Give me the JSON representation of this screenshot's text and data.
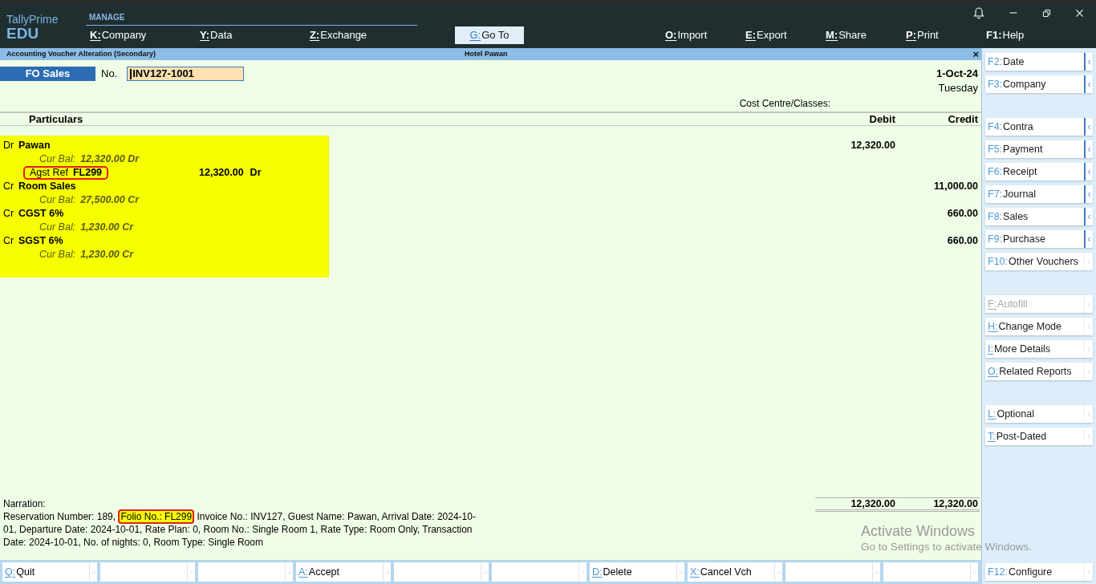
{
  "app": {
    "name": "TallyPrime",
    "edition": "EDU"
  },
  "top_menu": {
    "section": "MANAGE",
    "left_items": [
      {
        "key": "K:",
        "label": "Company"
      },
      {
        "key": "Y:",
        "label": "Data"
      },
      {
        "key": "Z:",
        "label": "Exchange"
      }
    ],
    "go_to": {
      "key": "G:",
      "label": "Go To",
      "selected": true
    },
    "right_items": [
      {
        "key": "O:",
        "label": "Import"
      },
      {
        "key": "E:",
        "label": "Export"
      },
      {
        "key": "M:",
        "label": "Share"
      },
      {
        "key": "P:",
        "label": "Print"
      },
      {
        "key": "F1:",
        "label": "Help"
      }
    ]
  },
  "title_bar": {
    "title": "Accounting Voucher Alteration (Secondary)",
    "company": "Hotel Pawan",
    "close": "×"
  },
  "voucher": {
    "type": "FO Sales",
    "no_label": "No.",
    "number": "INV127-1001",
    "date": "1-Oct-24",
    "day": "Tuesday",
    "cost_centre_label": "Cost Centre/Classes:"
  },
  "columns": [
    "Particulars",
    "Debit",
    "Credit"
  ],
  "entries": [
    {
      "side": "Dr",
      "ledger": "Pawan",
      "balance_label": "Cur Bal:",
      "balance": "12,320.00 Dr",
      "debit": "12,320.00",
      "bill": {
        "type": "Agst Ref",
        "name": "FL299",
        "amount": "12,320.00",
        "side": "Dr",
        "highlighted": true
      }
    },
    {
      "side": "Cr",
      "ledger": "Room Sales",
      "balance_label": "Cur Bal:",
      "balance": "27,500.00 Cr",
      "credit": "11,000.00"
    },
    {
      "side": "Cr",
      "ledger": "CGST 6%",
      "balance_label": "Cur Bal:",
      "balance": "1,230.00 Cr",
      "credit": "660.00"
    },
    {
      "side": "Cr",
      "ledger": "SGST 6%",
      "balance_label": "Cur Bal:",
      "balance": "1,230.00 Cr",
      "credit": "660.00"
    }
  ],
  "totals": {
    "debit": "12,320.00",
    "credit": "12,320.00"
  },
  "narration": {
    "label": "Narration:",
    "text_before": "Reservation Number: 189, ",
    "highlight": "Folio No.: FL299",
    "text_after": " Invoice No.: INV127, Guest Name: Pawan, Arrival Date: 2024-10-01, Departure Date: 2024-10-01, Rate Plan: 0, Room No.: Single Room 1, Rate Type: Room Only, Transaction Date: 2024-10-01, No. of nights: 0, Room Type: Single Room"
  },
  "right_panel": [
    [
      {
        "key": "F2:",
        "label": "Date",
        "disabled": false,
        "expandable": true
      },
      {
        "key": "F3:",
        "label": "Company",
        "disabled": false,
        "expandable": true
      }
    ],
    [
      {
        "key": "F4:",
        "label": "Contra",
        "disabled": false,
        "expandable": true
      },
      {
        "key": "F5:",
        "label": "Payment",
        "disabled": false,
        "expandable": true
      },
      {
        "key": "F6:",
        "label": "Receipt",
        "disabled": false,
        "expandable": true
      },
      {
        "key": "F7:",
        "label": "Journal",
        "disabled": false,
        "expandable": true
      },
      {
        "key": "F8:",
        "label": "Sales",
        "disabled": false,
        "expandable": true
      },
      {
        "key": "F9:",
        "label": "Purchase",
        "disabled": false,
        "expandable": true
      },
      {
        "key": "F10:",
        "label": "Other Vouchers",
        "disabled": false,
        "expandable": false
      }
    ],
    [
      {
        "key": "F:",
        "label": "Autofill",
        "disabled": true,
        "expandable": false
      },
      {
        "key": "H:",
        "label": "Change Mode",
        "disabled": false,
        "expandable": false
      },
      {
        "key": "I:",
        "label": "More Details",
        "disabled": false,
        "expandable": false
      },
      {
        "key": "O:",
        "label": "Related Reports",
        "disabled": false,
        "expandable": false
      }
    ],
    [
      {
        "key": "L:",
        "label": "Optional",
        "disabled": false,
        "expandable": false
      },
      {
        "key": "T:",
        "label": "Post-Dated",
        "disabled": false,
        "expandable": false
      }
    ]
  ],
  "bottom_bar": [
    {
      "kind": "action",
      "key": "Q:",
      "label": "Quit"
    },
    {
      "kind": "blank"
    },
    {
      "kind": "blank"
    },
    {
      "kind": "action",
      "key": "A:",
      "label": "Accept"
    },
    {
      "kind": "blank"
    },
    {
      "kind": "blank"
    },
    {
      "kind": "action",
      "key": "D:",
      "label": "Delete"
    },
    {
      "kind": "action",
      "key": "X:",
      "label": "Cancel Vch"
    },
    {
      "kind": "blank"
    },
    {
      "kind": "blank"
    }
  ],
  "configure": {
    "key": "F12:",
    "label": "Configure",
    "disabled": false,
    "expandable": false
  },
  "os_notice": {
    "title": "Activate Windows",
    "text": "Go to Settings to activate Windows."
  }
}
